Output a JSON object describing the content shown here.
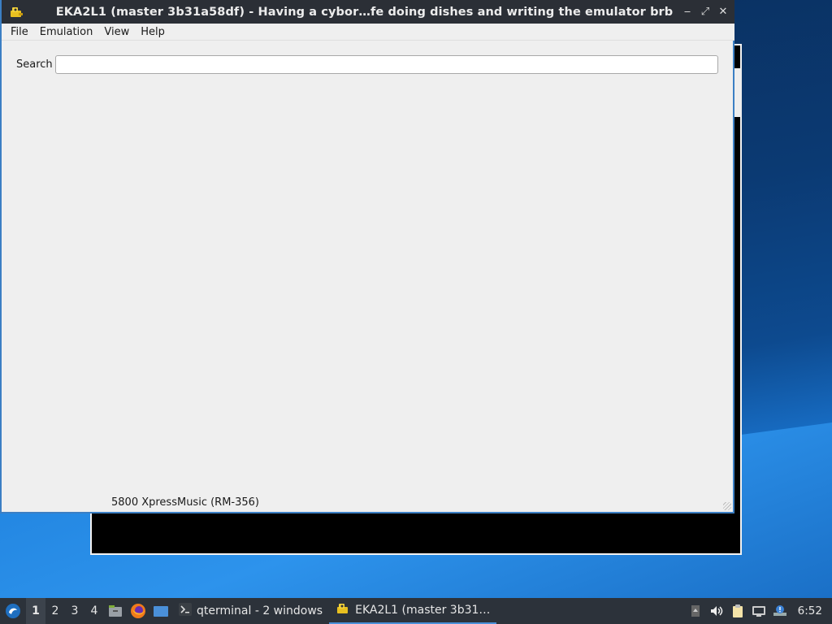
{
  "window": {
    "title": "EKA2L1 (master 3b31a58df) - Having a cybor…fe doing dishes and writing the emulator brb",
    "controls": {
      "minimize": "‒",
      "maximize": "⤢",
      "close": "✕"
    }
  },
  "menu": {
    "items": [
      "File",
      "Emulation",
      "View",
      "Help"
    ]
  },
  "search": {
    "label": "Search",
    "value": "",
    "placeholder": ""
  },
  "status": {
    "device": "5800 XpressMusic (RM-356)"
  },
  "taskbar": {
    "workspaces": [
      "1",
      "2",
      "3",
      "4"
    ],
    "active_workspace": "1",
    "tasks": [
      {
        "label": "qterminal - 2 windows",
        "icon": "terminal-icon"
      },
      {
        "label": "EKA2L1 (master 3b31…",
        "icon": "eka2l1-icon"
      }
    ],
    "clock": "6:52"
  },
  "colors": {
    "accent": "#4a90d9",
    "titlebar": "#2b2f36",
    "window_bg": "#efefef"
  }
}
